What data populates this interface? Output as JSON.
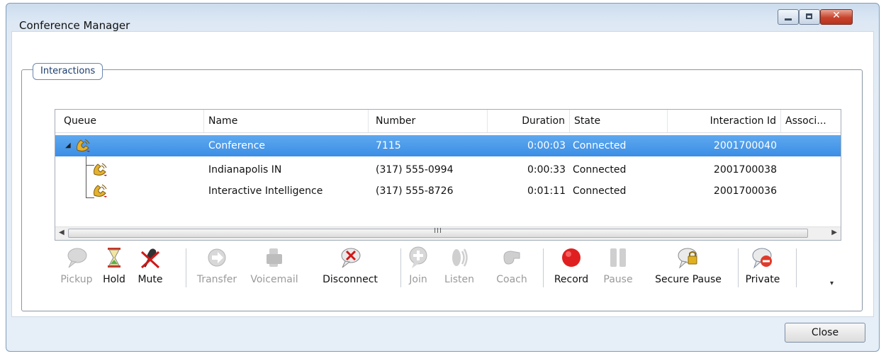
{
  "window": {
    "title": "Conference Manager"
  },
  "group": {
    "label": "Interactions"
  },
  "grid": {
    "columns": [
      "Queue",
      "Name",
      "Number",
      "Duration",
      "State",
      "Interaction Id",
      "Associ..."
    ],
    "rows": [
      {
        "name": "Conference",
        "number": "7115",
        "duration": "0:00:03",
        "state": "Connected",
        "interaction_id": "2001700040",
        "selected": true
      },
      {
        "name": "Indianapolis IN",
        "number": "(317) 555-0994",
        "duration": "0:00:33",
        "state": "Connected",
        "interaction_id": "2001700038",
        "selected": false
      },
      {
        "name": "Interactive Intelligence",
        "number": "(317) 555-8726",
        "duration": "0:01:11",
        "state": "Connected",
        "interaction_id": "2001700036",
        "selected": false
      }
    ],
    "scrollbar_grip": "III"
  },
  "toolbar": {
    "buttons": [
      {
        "label": "Pickup",
        "icon": "speech-bubble-icon",
        "enabled": false
      },
      {
        "label": "Hold",
        "icon": "hourglass-icon",
        "enabled": true
      },
      {
        "label": "Mute",
        "icon": "muted-microphone-icon",
        "enabled": true
      },
      {
        "label": "Transfer",
        "icon": "transfer-arrow-icon",
        "enabled": false
      },
      {
        "label": "Voicemail",
        "icon": "voicemail-icon",
        "enabled": false
      },
      {
        "label": "Disconnect",
        "icon": "disconnect-icon",
        "enabled": true
      },
      {
        "label": "Join",
        "icon": "join-plus-icon",
        "enabled": false
      },
      {
        "label": "Listen",
        "icon": "listen-speaker-icon",
        "enabled": false
      },
      {
        "label": "Coach",
        "icon": "coach-whistle-icon",
        "enabled": false
      },
      {
        "label": "Record",
        "icon": "record-dot-icon",
        "enabled": true
      },
      {
        "label": "Pause",
        "icon": "pause-icon",
        "enabled": false
      },
      {
        "label": "Secure Pause",
        "icon": "secure-pause-lock-icon",
        "enabled": true
      },
      {
        "label": "Private",
        "icon": "private-icon",
        "enabled": true
      }
    ]
  },
  "footer": {
    "close_label": "Close"
  },
  "colors": {
    "selection": "#3b8ee5",
    "record": "#e02020",
    "accent": "#1a3d6e"
  }
}
